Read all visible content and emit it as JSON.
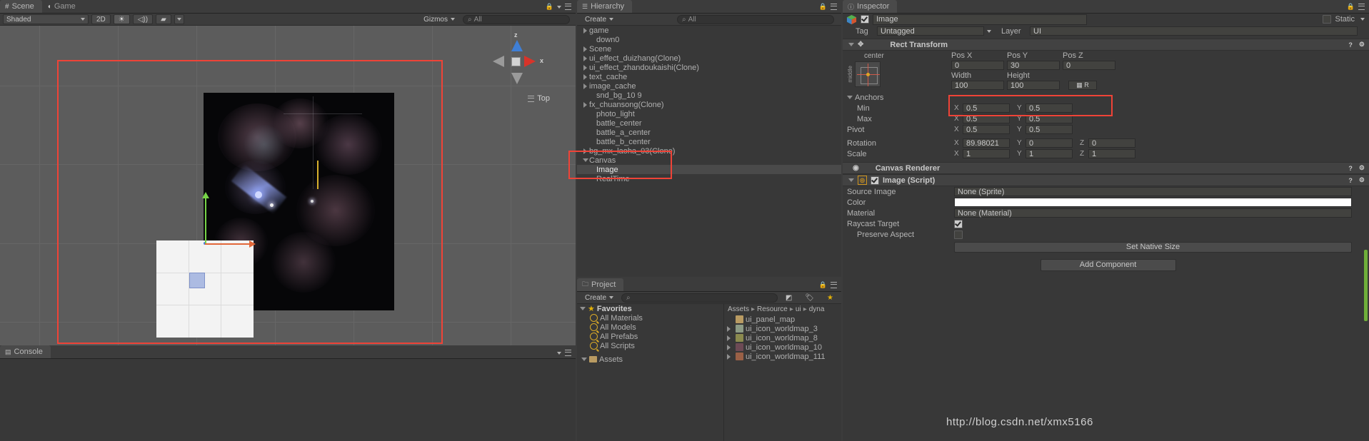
{
  "scene": {
    "tabs": [
      {
        "label": "Scene",
        "icon": "grid-icon",
        "active": true
      },
      {
        "label": "Game",
        "icon": "gamepad-icon",
        "active": false
      }
    ],
    "toolbar": {
      "shading": "Shaded",
      "mode_2d": "2D",
      "light_icon": "light-toggle-icon",
      "audio_icon": "audio-toggle-icon",
      "fx_icon": "effects-toggle-icon",
      "gizmos": "Gizmos",
      "search_placeholder": "All"
    },
    "gizmo": {
      "axis_z": "z",
      "axis_x": "x",
      "view_label": "Top"
    }
  },
  "console": {
    "tab_label": "Console"
  },
  "hierarchy": {
    "tab_label": "Hierarchy",
    "create_label": "Create",
    "search_placeholder": "All",
    "items": [
      {
        "label": "game",
        "depth": 0,
        "expandable": true,
        "selected": false
      },
      {
        "label": "down0",
        "depth": 1,
        "expandable": false,
        "selected": false
      },
      {
        "label": "Scene",
        "depth": 0,
        "expandable": true,
        "selected": false
      },
      {
        "label": "ui_effect_duizhang(Clone)",
        "depth": 0,
        "expandable": true,
        "selected": false
      },
      {
        "label": "ui_effect_zhandoukaishi(Clone)",
        "depth": 0,
        "expandable": true,
        "selected": false
      },
      {
        "label": "text_cache",
        "depth": 0,
        "expandable": true,
        "selected": false
      },
      {
        "label": "image_cache",
        "depth": 0,
        "expandable": true,
        "selected": false
      },
      {
        "label": "snd_bg_10 9",
        "depth": 1,
        "expandable": false,
        "selected": false
      },
      {
        "label": "fx_chuansong(Clone)",
        "depth": 0,
        "expandable": true,
        "selected": false
      },
      {
        "label": "photo_light",
        "depth": 1,
        "expandable": false,
        "selected": false
      },
      {
        "label": "battle_center",
        "depth": 1,
        "expandable": false,
        "selected": false
      },
      {
        "label": "battle_a_center",
        "depth": 1,
        "expandable": false,
        "selected": false
      },
      {
        "label": "battle_b_center",
        "depth": 1,
        "expandable": false,
        "selected": false
      },
      {
        "label": "bg_mx_laoha_03(Clone)",
        "depth": 0,
        "expandable": true,
        "selected": false
      },
      {
        "label": "Canvas",
        "depth": 0,
        "expandable": true,
        "expanded": true,
        "selected": false
      },
      {
        "label": "Image",
        "depth": 1,
        "expandable": false,
        "selected": true
      },
      {
        "label": "RealTime",
        "depth": 1,
        "expandable": false,
        "selected": false
      }
    ]
  },
  "project": {
    "tab_label": "Project",
    "create_label": "Create",
    "search_placeholder": "",
    "favorites_label": "Favorites",
    "favorites": [
      {
        "label": "All Materials"
      },
      {
        "label": "All Models"
      },
      {
        "label": "All Prefabs"
      },
      {
        "label": "All Scripts"
      }
    ],
    "assets_label": "Assets",
    "breadcrumb": [
      "Assets",
      "Resource",
      "ui",
      "dyna"
    ],
    "files": [
      {
        "label": "ui_panel_map",
        "type": "folder",
        "color": "#b99b62"
      },
      {
        "label": "ui_icon_worldmap_3",
        "type": "texture",
        "color": "#8d9b85"
      },
      {
        "label": "ui_icon_worldmap_8",
        "type": "texture",
        "color": "#8b8a4e"
      },
      {
        "label": "ui_icon_worldmap_10",
        "type": "texture",
        "color": "#6d4a55"
      },
      {
        "label": "ui_icon_worldmap_111",
        "type": "texture",
        "color": "#9a6046"
      }
    ]
  },
  "inspector": {
    "tab_label": "Inspector",
    "object_name": "Image",
    "object_enabled": true,
    "static_label": "Static",
    "tag_label": "Tag",
    "tag_value": "Untagged",
    "layer_label": "Layer",
    "layer_value": "UI",
    "rect_transform": {
      "title": "Rect Transform",
      "preset_label": "center",
      "preset_vertical_label": "middle",
      "pos_x_label": "Pos X",
      "pos_y_label": "Pos Y",
      "pos_z_label": "Pos Z",
      "pos_x": "0",
      "pos_y": "30",
      "pos_z": "0",
      "width_label": "Width",
      "height_label": "Height",
      "width": "100",
      "height": "100",
      "anchors_label": "Anchors",
      "min_label": "Min",
      "max_label": "Max",
      "pivot_label": "Pivot",
      "min_x": "0.5",
      "min_y": "0.5",
      "max_x": "0.5",
      "max_y": "0.5",
      "pivot_x": "0.5",
      "pivot_y": "0.5",
      "rotation_label": "Rotation",
      "rot_x": "89.98021",
      "rot_y": "0",
      "rot_z": "0",
      "scale_label": "Scale",
      "scale_x": "1",
      "scale_y": "1",
      "scale_z": "1",
      "axis_x": "X",
      "axis_y": "Y",
      "axis_z": "Z"
    },
    "canvas_renderer": {
      "title": "Canvas Renderer"
    },
    "image_script": {
      "title": "Image (Script)",
      "enabled": true,
      "source_image_label": "Source Image",
      "source_image_value": "None (Sprite)",
      "color_label": "Color",
      "color_value": "#FFFFFF",
      "material_label": "Material",
      "material_value": "None (Material)",
      "raycast_target_label": "Raycast Target",
      "raycast_target_checked": true,
      "preserve_aspect_label": "Preserve Aspect",
      "preserve_aspect_checked": false,
      "set_native_size_label": "Set Native Size"
    },
    "add_component_label": "Add Component"
  },
  "annotations": {
    "highlight_color": "#ef4337"
  },
  "watermark": {
    "text": "http://blog.csdn.net/xmx5166"
  }
}
